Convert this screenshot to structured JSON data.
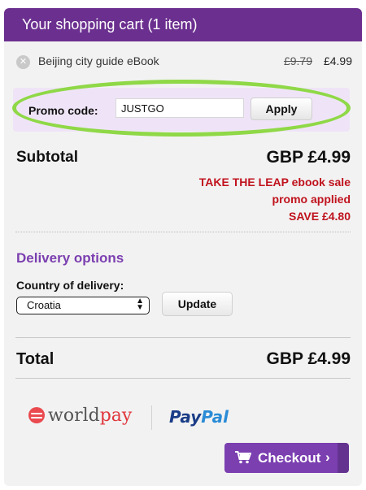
{
  "header": {
    "title": "Your shopping cart (1 item)"
  },
  "item": {
    "name": "Beijing city guide eBook",
    "price_old": "£9.79",
    "price_new": "£4.99",
    "remove_icon": "close-icon"
  },
  "promo": {
    "label": "Promo code:",
    "value": "JUSTGO",
    "apply_label": "Apply",
    "highlight_color": "#8fd847"
  },
  "subtotal": {
    "label": "Subtotal",
    "value": "GBP £4.99",
    "promo_lines": [
      "TAKE THE LEAP ebook sale",
      "promo applied",
      "SAVE £4.80"
    ]
  },
  "delivery": {
    "title": "Delivery options",
    "country_label": "Country of delivery:",
    "country_selected": "Croatia",
    "update_label": "Update"
  },
  "total": {
    "label": "Total",
    "value": "GBP £4.99"
  },
  "payments": {
    "worldpay_a": "world",
    "worldpay_b": "pay",
    "paypal_a": "Pay",
    "paypal_b": "Pal"
  },
  "checkout": {
    "label": "Checkout",
    "chevron": "›"
  },
  "colors": {
    "brand_purple": "#6b2f8f",
    "promo_red": "#c0121d",
    "panel_bg": "#f2f2f2"
  }
}
